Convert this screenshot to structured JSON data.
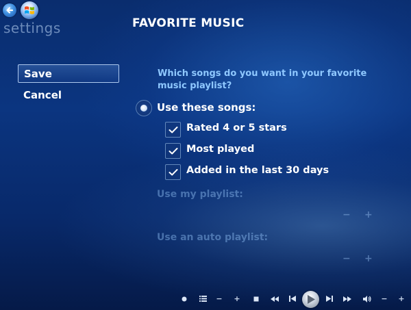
{
  "header": {
    "section": "settings",
    "title": "FAVORITE MUSIC"
  },
  "menu": {
    "save_label": "Save",
    "cancel_label": "Cancel"
  },
  "main": {
    "question": "Which songs do you want in your favorite music playlist?",
    "use_songs_option": {
      "label": "Use these songs:",
      "selected": true,
      "criteria": [
        {
          "label": "Rated 4 or 5 stars",
          "checked": true
        },
        {
          "label": "Most played",
          "checked": true
        },
        {
          "label": "Added in the last 30 days",
          "checked": true
        }
      ]
    },
    "use_playlist_option": {
      "label": "Use my playlist:",
      "minus": "−",
      "plus": "+"
    },
    "use_auto_playlist_option": {
      "label": "Use an auto playlist:",
      "minus": "−",
      "plus": "+"
    }
  },
  "transport": {
    "record_icon": "record-icon",
    "playlist_icon": "playlist-icon",
    "minus": "−",
    "plus": "+",
    "stop_icon": "stop-icon",
    "rewind_icon": "rewind-icon",
    "prev_icon": "previous-icon",
    "play_icon": "play-icon",
    "next_icon": "next-icon",
    "fast_forward_icon": "fast-forward-icon",
    "volume_icon": "volume-icon",
    "vol_minus": "−",
    "vol_plus": "+"
  },
  "colors": {
    "question_text": "#8fc8ff",
    "disabled_text": "#7aa5dc",
    "background_top": "#0a2d6e",
    "background_bottom": "#051a48"
  }
}
